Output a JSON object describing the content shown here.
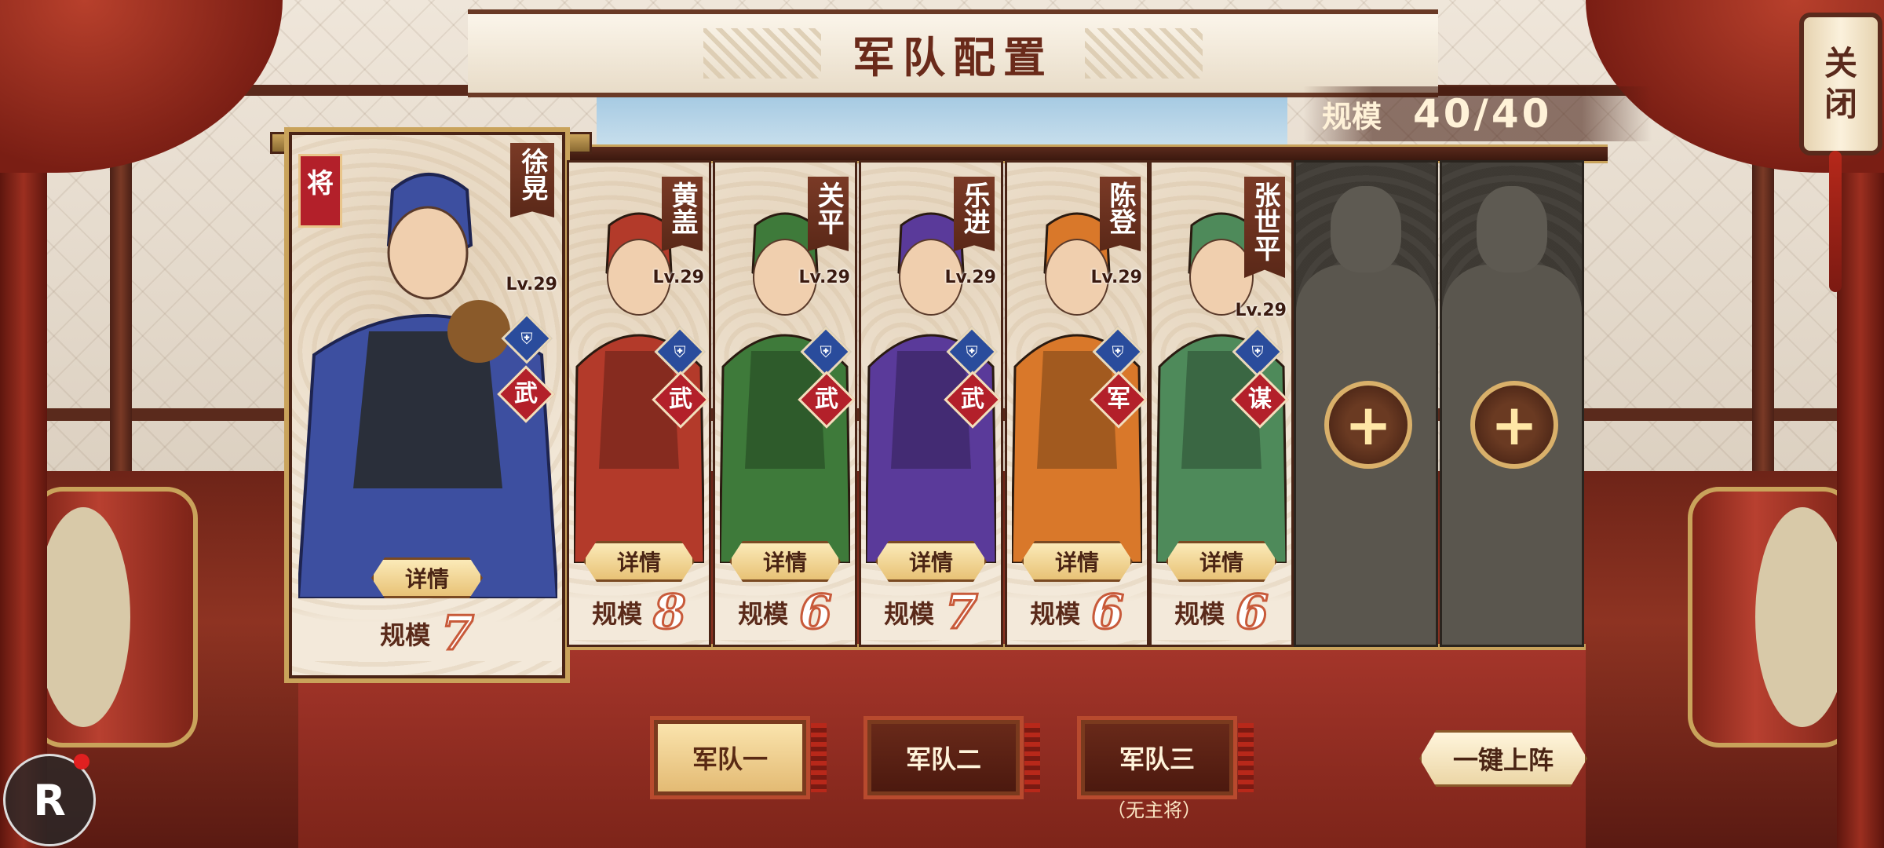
{
  "header": {
    "title": "军队配置"
  },
  "scale": {
    "label": "规模",
    "value": "40/40"
  },
  "close": {
    "label_line1": "关",
    "label_line2": "闭"
  },
  "leader_flag": "将",
  "generals": [
    {
      "name": "徐晃",
      "level": "Lv.29",
      "role": "武",
      "detail": "详情",
      "scale_label": "规模",
      "scale": "7",
      "leader": true,
      "color": "#3d4fa0"
    },
    {
      "name": "黄盖",
      "level": "Lv.29",
      "role": "武",
      "detail": "详情",
      "scale_label": "规模",
      "scale": "8",
      "leader": false,
      "color": "#b33a2a"
    },
    {
      "name": "关平",
      "level": "Lv.29",
      "role": "武",
      "detail": "详情",
      "scale_label": "规模",
      "scale": "6",
      "leader": false,
      "color": "#3e7a3a"
    },
    {
      "name": "乐进",
      "level": "Lv.29",
      "role": "武",
      "detail": "详情",
      "scale_label": "规模",
      "scale": "7",
      "leader": false,
      "color": "#5a3a9a"
    },
    {
      "name": "陈登",
      "level": "Lv.29",
      "role": "军",
      "detail": "详情",
      "scale_label": "规模",
      "scale": "6",
      "leader": false,
      "color": "#d9782a"
    },
    {
      "name": "张世平",
      "level": "Lv.29",
      "role": "谋",
      "detail": "详情",
      "scale_label": "规模",
      "scale": "6",
      "leader": false,
      "color": "#4e8a5a"
    }
  ],
  "empty_slot": {
    "add_symbol": "+"
  },
  "teams": [
    {
      "label": "军队一",
      "active": true
    },
    {
      "label": "军队二",
      "active": false
    },
    {
      "label": "军队三",
      "active": false,
      "note": "（无主将）"
    }
  ],
  "auto_deploy": {
    "label": "一键上阵"
  },
  "record_badge": {
    "label": "R"
  }
}
